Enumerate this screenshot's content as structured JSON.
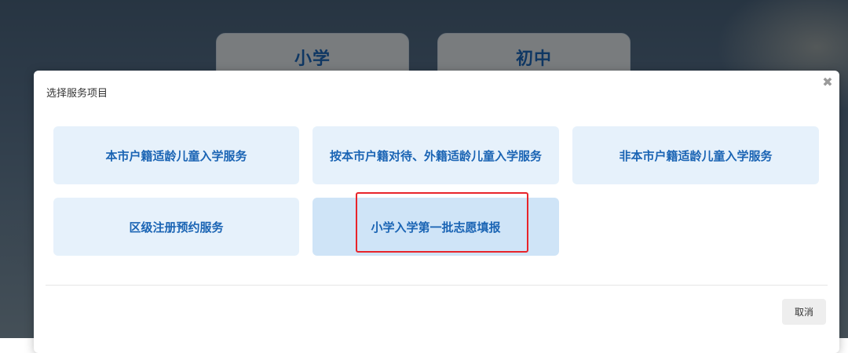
{
  "background": {
    "tabs": [
      {
        "label": "小学"
      },
      {
        "label": "初中"
      }
    ]
  },
  "modal": {
    "title": "选择服务项目",
    "close_icon": "close-icon",
    "services": [
      {
        "label": "本市户籍适龄儿童入学服务"
      },
      {
        "label": "按本市户籍对待、外籍适龄儿童入学服务"
      },
      {
        "label": "非本市户籍适龄儿童入学服务"
      },
      {
        "label": "区级注册预约服务"
      },
      {
        "label": "小学入学第一批志愿填报"
      }
    ],
    "cancel_label": "取消"
  },
  "colors": {
    "accent_text": "#1a64b4",
    "button_bg": "#e6f1fb",
    "highlight": "#e8242a"
  }
}
